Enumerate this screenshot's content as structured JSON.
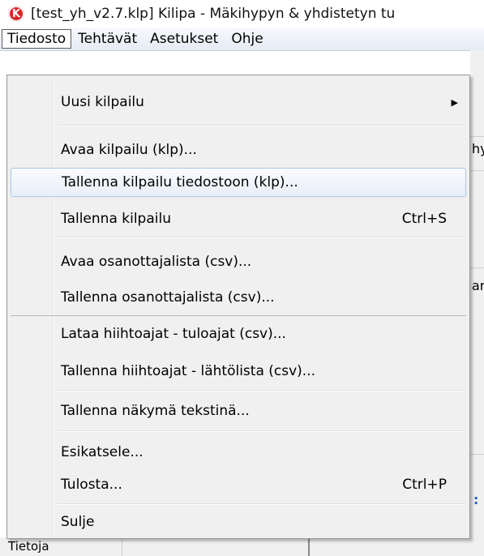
{
  "window": {
    "icon_letter": "K",
    "title": "[test_yh_v2.7.klp] Kilipa - Mäkihypyn & yhdistetyn tu"
  },
  "menubar": {
    "items": [
      "Tiedosto",
      "Tehtävät",
      "Asetukset",
      "Ohje"
    ]
  },
  "file_menu": {
    "new_competition": "Uusi kilpailu",
    "open_competition": "Avaa kilpailu (klp)...",
    "save_to_file": "Tallenna kilpailu tiedostoon (klp)...",
    "save_competition": "Tallenna kilpailu",
    "save_competition_shortcut": "Ctrl+S",
    "open_participants": "Avaa osanottajalista (csv)...",
    "save_participants": "Tallenna osanottajalista (csv)...",
    "load_skiers": "Lataa hiihtoajat - tuloajat (csv)...",
    "save_skiers": "Tallenna hiihtoajat - lähtölista (csv)...",
    "save_view": "Tallenna näkymä tekstinä...",
    "preview": "Esikatsele...",
    "print": "Tulosta...",
    "print_shortcut": "Ctrl+P",
    "close": "Sulje"
  },
  "background": {
    "status_text": "Tietoja",
    "snippet_1": "hy",
    "snippet_2": "ar",
    "snippet_3": ":"
  }
}
